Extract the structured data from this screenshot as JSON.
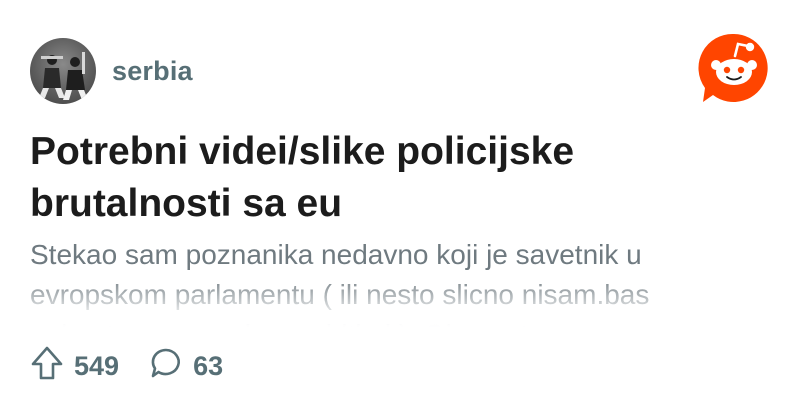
{
  "header": {
    "subreddit": "serbia",
    "avatar_icon": "subreddit-avatar-icon",
    "logo_icon": "reddit-logo-icon",
    "brand_color": "#ff4500"
  },
  "post": {
    "title": "Potrebni videi/slike policijske brutalnosti sa eu",
    "body": "Stekao sam poznanika nedavno koji je savetnik u evropskom parlamentu ( ili nesto slicno nisam.bas pohvatao, pomocic ce ubiti ok). Obavestavam se o"
  },
  "stats": {
    "upvote_icon": "upvote-arrow-icon",
    "upvotes": "549",
    "comment_icon": "comment-bubble-icon",
    "comments": "63"
  }
}
